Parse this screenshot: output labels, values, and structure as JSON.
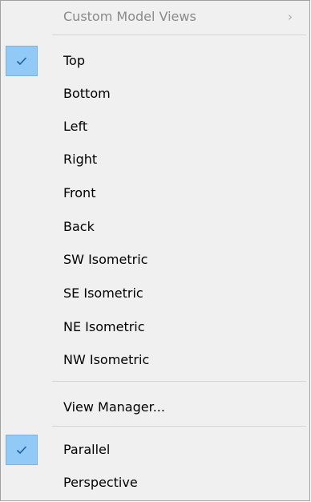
{
  "menu": {
    "custom_model_views": {
      "label": "Custom Model Views",
      "arrow": "›",
      "enabled": false
    },
    "views": [
      {
        "label": "Top",
        "checked": true
      },
      {
        "label": "Bottom",
        "checked": false
      },
      {
        "label": "Left",
        "checked": false
      },
      {
        "label": "Right",
        "checked": false
      },
      {
        "label": "Front",
        "checked": false
      },
      {
        "label": "Back",
        "checked": false
      },
      {
        "label": "SW Isometric",
        "checked": false
      },
      {
        "label": "SE Isometric",
        "checked": false
      },
      {
        "label": "NE Isometric",
        "checked": false
      },
      {
        "label": "NW Isometric",
        "checked": false
      }
    ],
    "view_manager": {
      "label": "View Manager..."
    },
    "projection": [
      {
        "label": "Parallel",
        "checked": true
      },
      {
        "label": "Perspective",
        "checked": false
      }
    ]
  },
  "icons": {
    "check": "checkmark-icon",
    "submenu": "chevron-right-icon"
  },
  "colors": {
    "menu_background": "#f0f0f0",
    "menu_border": "#a0a0a0",
    "check_highlight": "#91c9f7",
    "check_highlight_border": "#7ab3e3",
    "check_mark": "#1f5f99",
    "disabled_text": "#8a8a8a"
  }
}
